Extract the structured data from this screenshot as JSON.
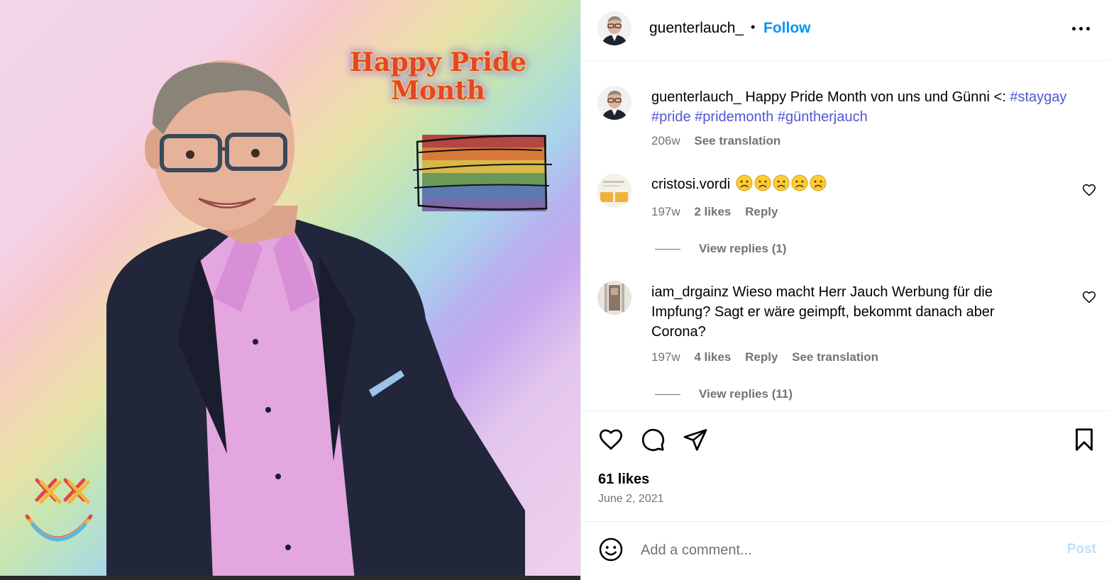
{
  "post": {
    "username": "guenterlauch_",
    "separator": "•",
    "follow_label": "Follow"
  },
  "image": {
    "sticker_text_line1": "Happy Pride",
    "sticker_text_line2": "Month"
  },
  "caption": {
    "username": "guenterlauch_",
    "text": " Happy Pride Month von uns und Günni <: ",
    "hashtags": [
      "#staygay",
      "#pride",
      "#pridemonth",
      "#güntherjauch"
    ],
    "age": "206w",
    "see_translation": "See translation"
  },
  "comments": [
    {
      "username": "cristosi.vordi",
      "text": "😥😥😥😥😥",
      "age": "197w",
      "likes": "2 likes",
      "reply": "Reply",
      "view_replies": "View replies (1)"
    },
    {
      "username": "iam_drgainz",
      "text": " Wieso macht Herr Jauch Werbung für die Impfung? Sagt er wäre geimpft, bekommt danach aber Corona?",
      "age": "197w",
      "likes": "4 likes",
      "reply": "Reply",
      "see_translation": "See translation",
      "view_replies": "View replies (11)"
    }
  ],
  "stats": {
    "likes": "61 likes",
    "date": "June 2, 2021"
  },
  "composer": {
    "placeholder": "Add a comment...",
    "post_label": "Post"
  },
  "colors": {
    "link_blue": "#0095f6",
    "hashtag": "#4f56d6",
    "secondary_text": "#737373",
    "divider": "#efefef"
  }
}
